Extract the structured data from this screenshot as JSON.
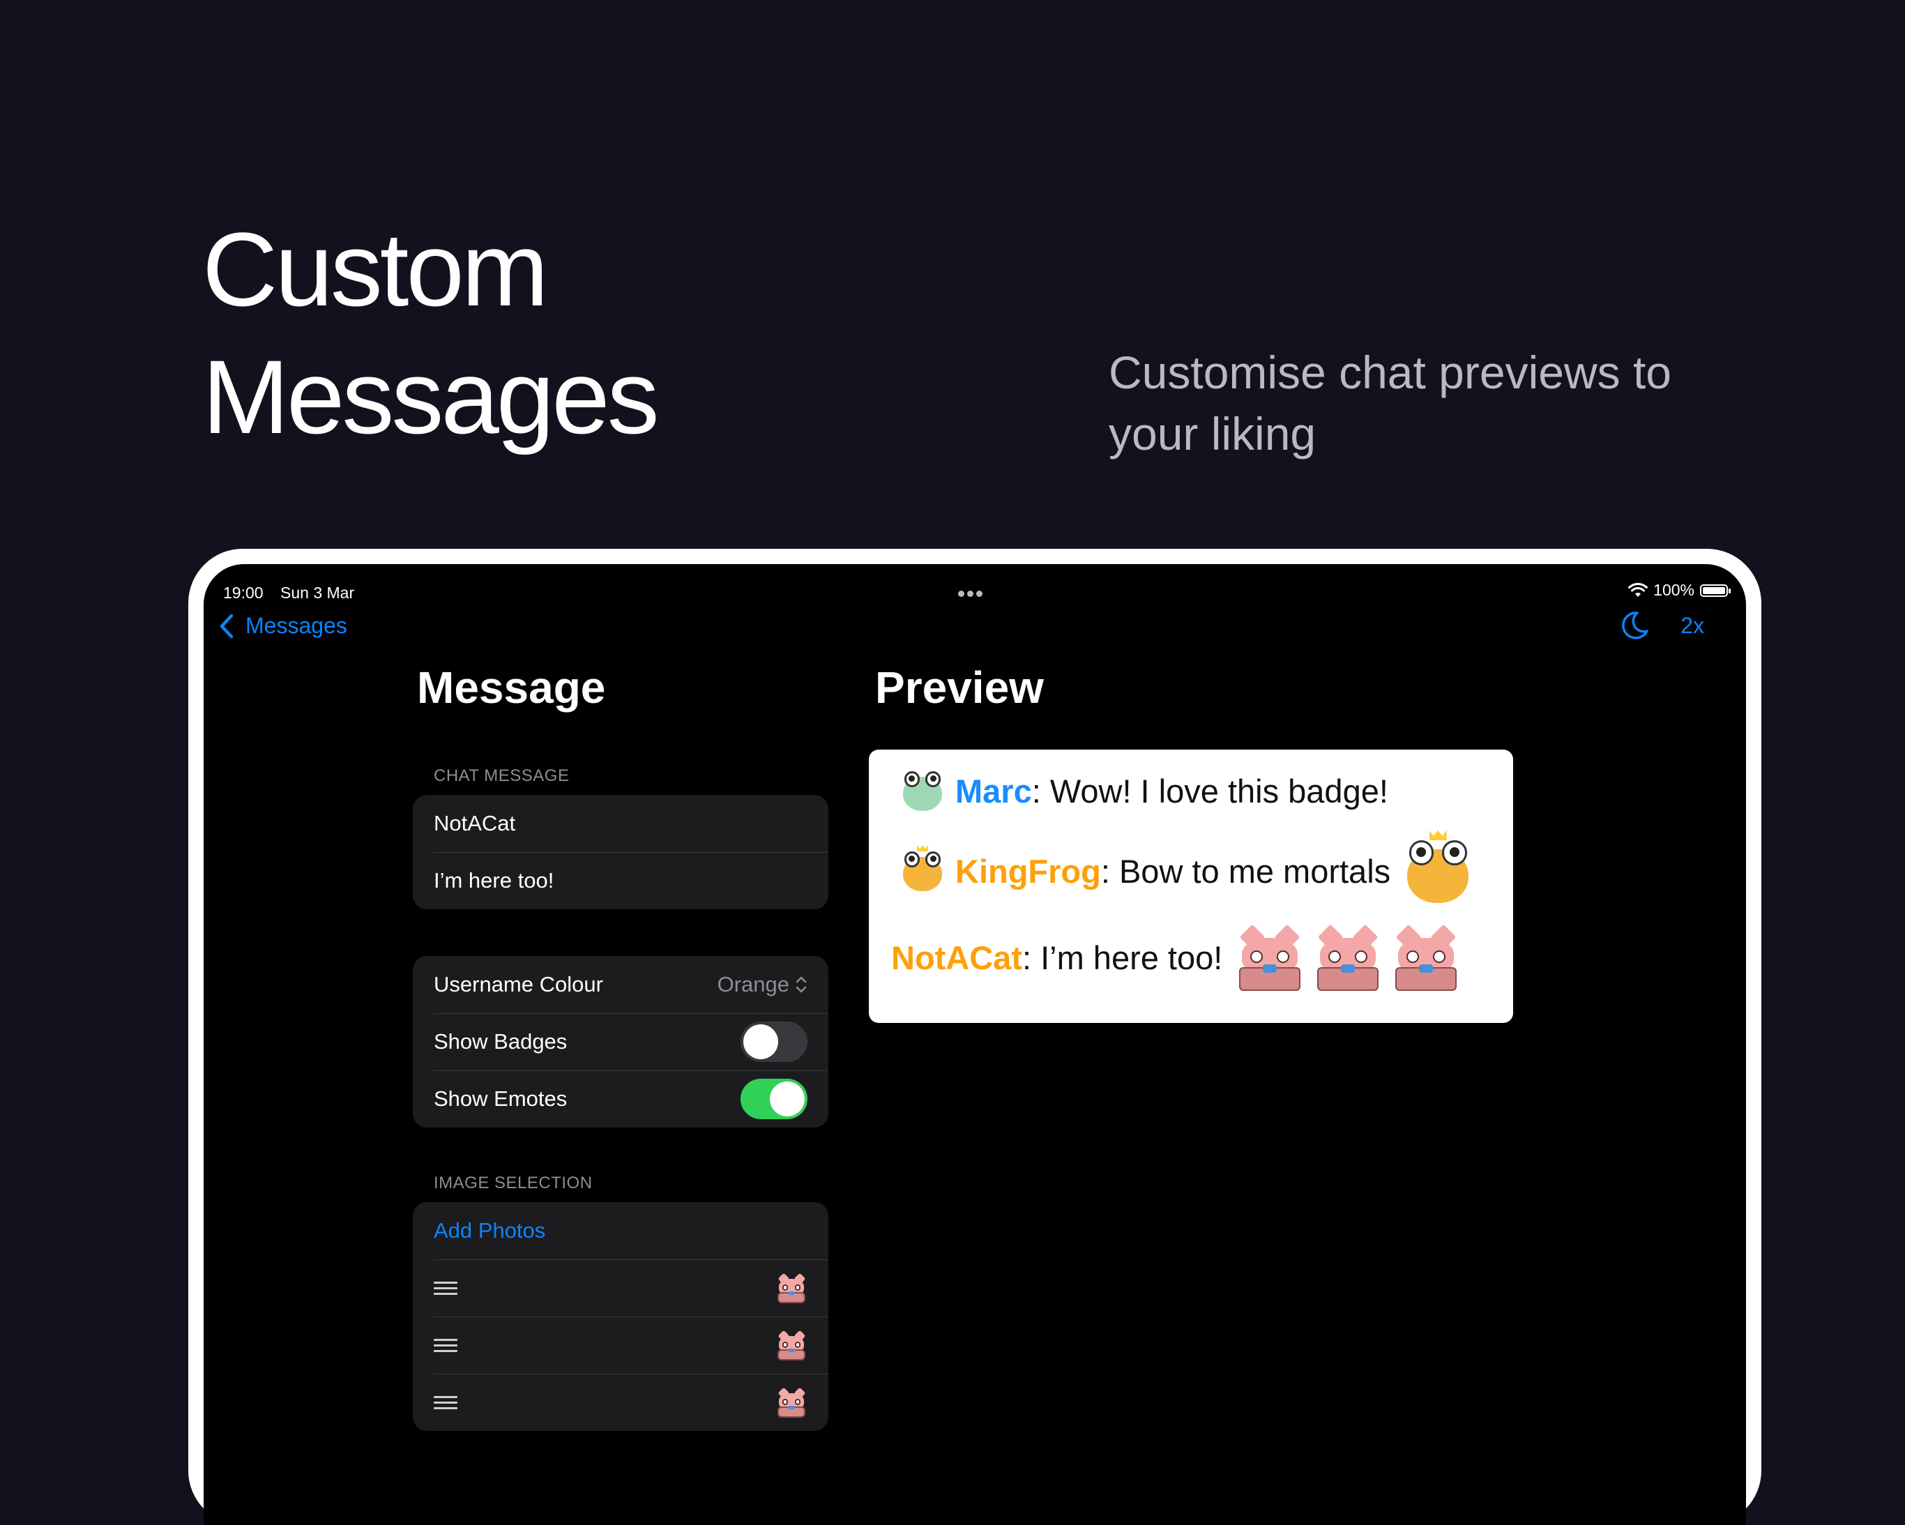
{
  "hero": {
    "title_line1": "Custom",
    "title_line2": "Messages",
    "subtitle_line1": "Customise chat previews to",
    "subtitle_line2": "your liking"
  },
  "status_bar": {
    "time": "19:00",
    "date": "Sun 3 Mar",
    "battery": "100%"
  },
  "nav": {
    "back_label": "Messages",
    "back_icon": "chevron-left-icon",
    "moon_icon": "moon-icon",
    "scale_label": "2x"
  },
  "message_panel": {
    "title": "Message",
    "chat_section_label": "CHAT MESSAGE",
    "username_value": "NotACat",
    "message_value": "I’m here too!",
    "username_colour_label": "Username Colour",
    "username_colour_value": "Orange",
    "show_badges_label": "Show Badges",
    "show_badges_on": false,
    "show_emotes_label": "Show Emotes",
    "show_emotes_on": true,
    "image_section_label": "IMAGE SELECTION",
    "add_photos_label": "Add Photos",
    "image_rows": 3
  },
  "preview_panel": {
    "title": "Preview",
    "lines": [
      {
        "username": "Marc",
        "color": "#1a8cff",
        "text": ": Wow! I love this badge!"
      },
      {
        "username": "KingFrog",
        "color": "#ff9f0a",
        "text": ": Bow to me mortals"
      },
      {
        "username": "NotACat",
        "color": "#ff9f0a",
        "text": ": I’m here too!"
      }
    ]
  },
  "colors": {
    "background": "#13111d",
    "accent": "#0a84ff",
    "toggle_on": "#30d158",
    "orange": "#ff9f0a"
  }
}
